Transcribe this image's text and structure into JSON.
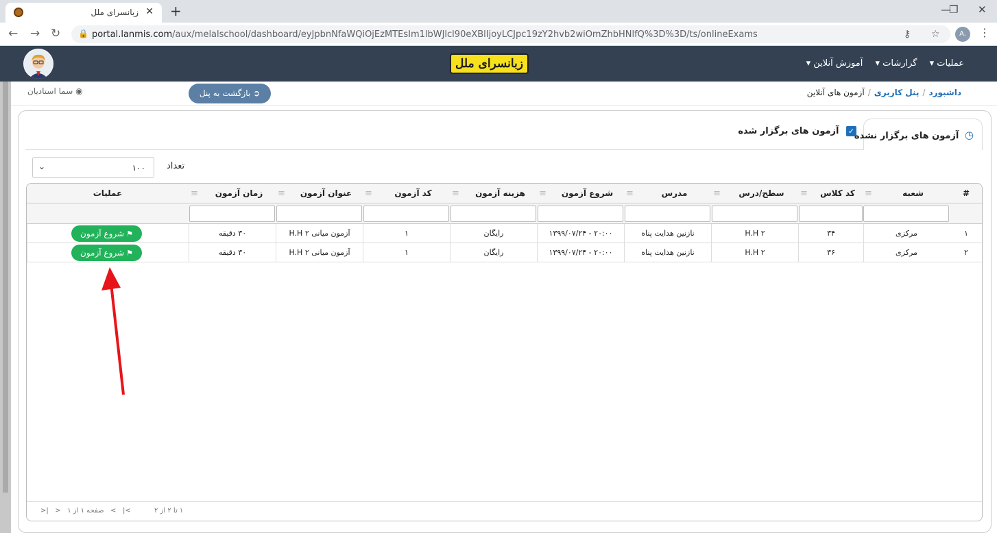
{
  "browser": {
    "tab_title": "زبانسرای ملل",
    "close_glyph": "✕",
    "new_tab_glyph": "+",
    "url_host": "portal.lanmis.com",
    "url_path": "/aux/melalschool/dashboard/eyJpbnNfaWQiOjEzMTEsIm1lbWJlcl90eXBlIjoyLCJpc19zY2hvb2wiOmZhbHNlfQ%3D%3D/ts/onlineExams",
    "profile_initial": "A."
  },
  "navbar": {
    "logo_text": "زبانسرای ملل",
    "menu": [
      "عملیات ▾",
      "گزارشات ▾",
      "آموزش آنلاین ▾"
    ]
  },
  "breadcrumb": {
    "items": [
      "داشبورد",
      "پنل کاربری",
      "آزمون های آنلاین"
    ],
    "separator": "/"
  },
  "back_button": "بازگشت به پنل",
  "user_name": "سما استادیان",
  "tabs": {
    "active": "آزمون های برگزار نشده",
    "inactive": "آزمون های برگزار شده"
  },
  "count": {
    "label": "تعداد",
    "value": "۱۰۰"
  },
  "table": {
    "columns": [
      "#",
      "شعبه",
      "کد کلاس",
      "سطح/درس",
      "مدرس",
      "شروع آزمون",
      "هزینه آزمون",
      "کد آزمون",
      "عنوان آزمون",
      "زمان آزمون",
      "عملیات"
    ],
    "rows": [
      {
        "num": "۱",
        "branch": "مرکزی",
        "class_code": "۳۴",
        "level": "H.H ۲",
        "teacher": "نازنین هدایت پناه",
        "start": "۲۰:۰۰ - ۱۳۹۹/۰۷/۲۴",
        "cost": "رایگان",
        "exam_code": "۱",
        "title": "آزمون میانی ۲ H.H",
        "duration": "۳۰ دقیقه",
        "action": "شروع آزمون"
      },
      {
        "num": "۲",
        "branch": "مرکزی",
        "class_code": "۳۶",
        "level": "H.H ۲",
        "teacher": "نازنین هدایت پناه",
        "start": "۲۰:۰۰ - ۱۳۹۹/۰۷/۲۴",
        "cost": "رایگان",
        "exam_code": "۱",
        "title": "آزمون میانی ۲ H.H",
        "duration": "۳۰ دقیقه",
        "action": "شروع آزمون"
      }
    ]
  },
  "pager": {
    "range": "۱ تا ۲ از ۲",
    "page_info": "صفحه ۱ از ۱",
    "first": "|<",
    "prev": "<",
    "next": ">",
    "last": ">|"
  },
  "colors": {
    "navbar": "#334152",
    "accent": "#1f6fb8",
    "start_button": "#21b25a",
    "annotation_arrow": "#e8141b"
  }
}
